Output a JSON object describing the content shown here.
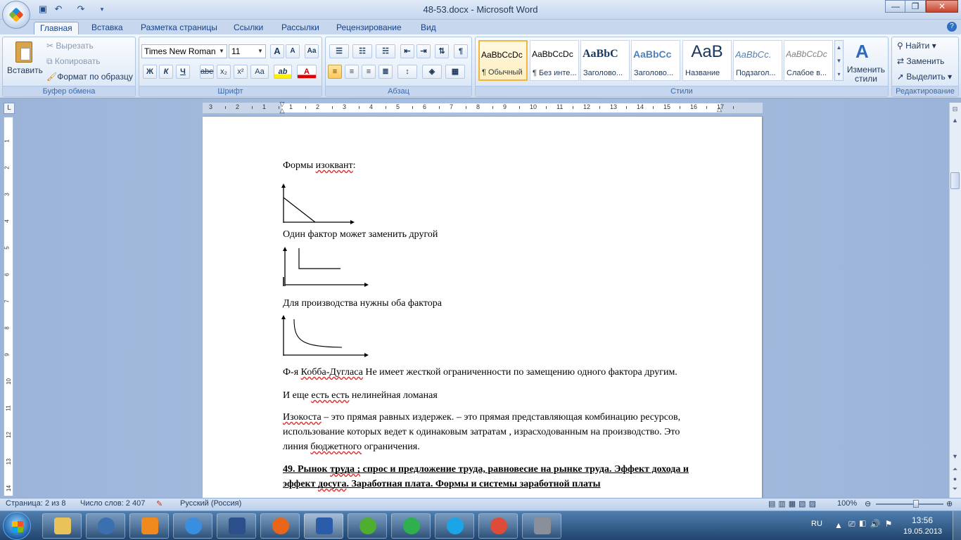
{
  "window": {
    "title": "48-53.docx - Microsoft Word",
    "controls": {
      "minimize": "—",
      "maximize": "❐",
      "close": "✕"
    }
  },
  "quick_access": [
    "save-icon",
    "undo-icon",
    "redo-icon",
    "customize-icon"
  ],
  "tabs": [
    "Главная",
    "Вставка",
    "Разметка страницы",
    "Ссылки",
    "Рассылки",
    "Рецензирование",
    "Вид"
  ],
  "active_tab": "Главная",
  "ribbon": {
    "clipboard": {
      "label": "Буфер обмена",
      "paste": "Вставить",
      "cut": "Вырезать",
      "copy": "Копировать",
      "format_painter": "Формат по образцу"
    },
    "font": {
      "label": "Шрифт",
      "font_name": "Times New Roman",
      "font_size": "11",
      "grow": "A",
      "shrink": "A",
      "clear": "Aa",
      "bold": "Ж",
      "italic": "К",
      "underline": "Ч",
      "strike": "abe",
      "subscript": "x₂",
      "superscript": "x²",
      "case": "Aa",
      "highlight": "ab",
      "color": "A"
    },
    "paragraph": {
      "label": "Абзац",
      "show_marks": "¶"
    },
    "styles": {
      "label": "Стили",
      "items": [
        {
          "preview": "AaBbCcDc",
          "name": "¶ Обычный"
        },
        {
          "preview": "AaBbCcDc",
          "name": "¶ Без инте..."
        },
        {
          "preview": "AaBbC",
          "name": "Заголово..."
        },
        {
          "preview": "AaBbCc",
          "name": "Заголово..."
        },
        {
          "preview": "AaB",
          "name": "Название"
        },
        {
          "preview": "AaBbCc.",
          "name": "Подзагол..."
        },
        {
          "preview": "AaBbCcDc",
          "name": "Слабое в..."
        }
      ],
      "change_styles": "Изменить стили"
    },
    "editing": {
      "label": "Редактирование",
      "find": "Найти",
      "replace": "Заменить",
      "select": "Выделить"
    }
  },
  "ruler": {
    "h_ticks": [
      "3",
      "2",
      "1",
      "1",
      "2",
      "3",
      "4",
      "5",
      "6",
      "7",
      "8",
      "9",
      "10",
      "11",
      "12",
      "13",
      "14",
      "15",
      "16",
      "17"
    ],
    "v_ticks": [
      "1",
      "2",
      "3",
      "4",
      "5",
      "6",
      "7",
      "8",
      "9",
      "10",
      "11",
      "12",
      "13",
      "14"
    ]
  },
  "document": {
    "p1": "Формы изоквант:",
    "p2": "Один фактор может заменить другой",
    "p3": "Для производства нужны оба фактора",
    "p4": "Ф-я Кобба-Дугласа Не имеет жесткой ограниченности по замещению одного  фактора другим.",
    "p5": "И еще есть есть нелинейная ломаная",
    "p6a": "Изокоста – это прямая равных издержек. – это прямая представляющая комбинацию ресурсов,",
    "p6b": "использование которых ведет к одинаковым затратам , израсходованным на производство. Это",
    "p6c": "линия бюджетного ограничения.",
    "h1a": "49. Рынок труда ; спрос и предложение труда, равновесие на рынке труда. Эффект дохода и",
    "h1b": "эффект  досуга. Заработная плата. Формы и системы заработной платы"
  },
  "status": {
    "page": "Страница: 2 из 8",
    "words": "Число слов: 2 407",
    "language": "Русский (Россия)",
    "zoom": "100%",
    "zoom_level": 100
  },
  "taskbar": {
    "apps": [
      "explorer-icon",
      "hp-icon",
      "media-player-icon",
      "internet-explorer-icon",
      "task-icon",
      "firefox-icon",
      "word-icon",
      "utorrent-icon",
      "mail-agent-icon",
      "skype-icon",
      "chrome-icon",
      "camera-icon"
    ],
    "lang": "RU",
    "time": "13:56",
    "date": "19.05.2013"
  }
}
